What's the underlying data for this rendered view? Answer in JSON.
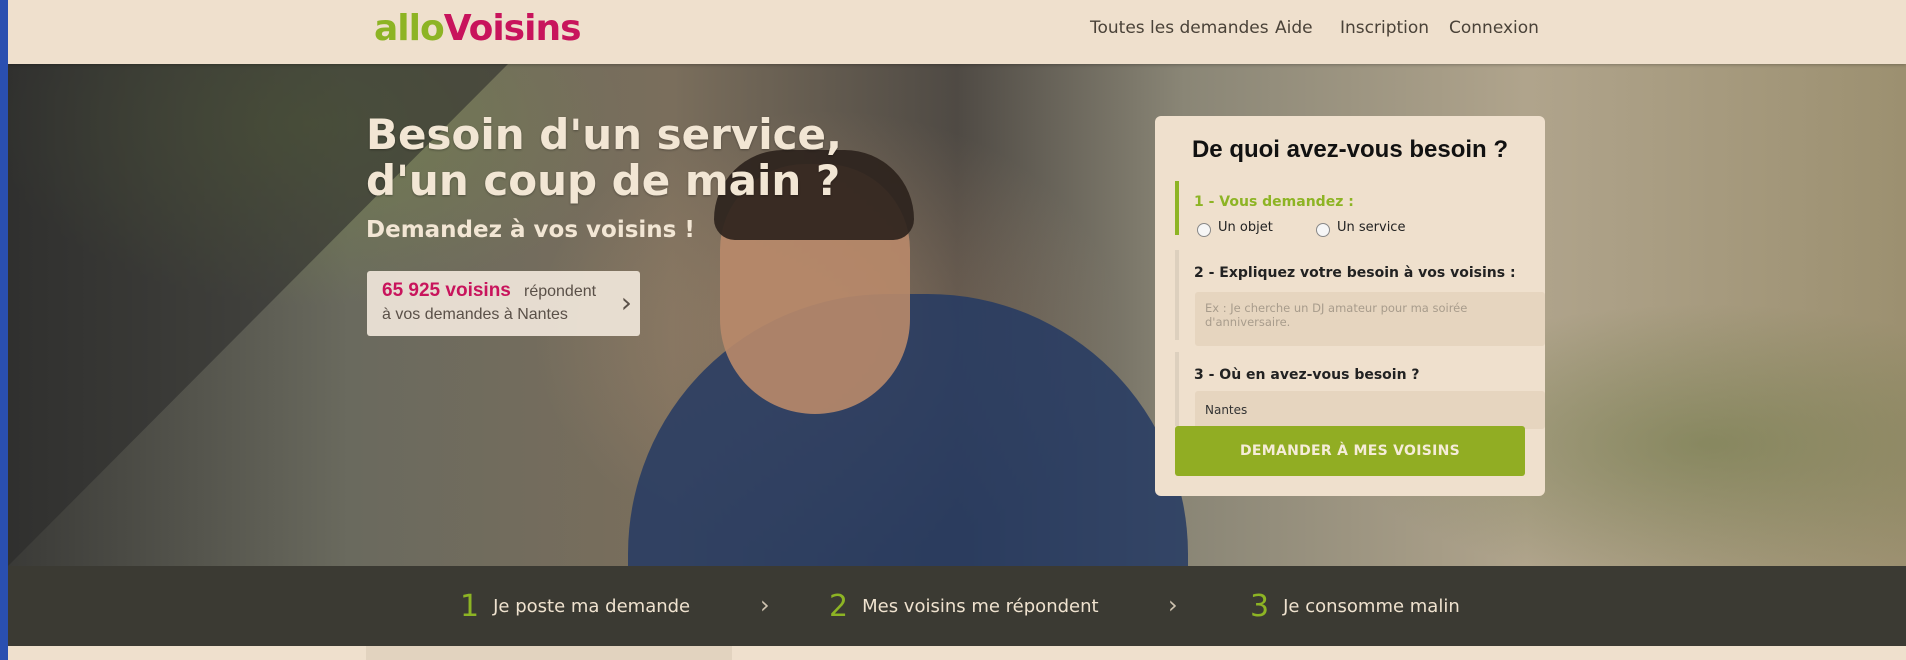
{
  "header": {
    "logo_part1": "allo",
    "logo_part2": "Voisins",
    "nav": [
      "Toutes les demandes",
      "Aide",
      "Inscription",
      "Connexion"
    ]
  },
  "hero": {
    "title": "Besoin d'un service,\nd'un coup de main ?",
    "subtitle": "Demandez à vos voisins !",
    "count_number": "65 925 voisins",
    "count_text1": "répondent",
    "count_text2": "à vos demandes à Nantes"
  },
  "form": {
    "title": "De quoi avez-vous besoin ?",
    "step1_label": "1 - Vous demandez :",
    "option1": "Un objet",
    "option2": "Un service",
    "step2_label": "2 - Expliquez votre besoin à vos voisins :",
    "need_placeholder": "Ex : Je cherche un DJ amateur pour ma soirée d'anniversaire.",
    "step3_label": "3 - Où en avez-vous besoin ?",
    "city_value": "Nantes",
    "submit_label": "DEMANDER À MES VOISINS"
  },
  "steps": [
    {
      "num": "1",
      "text": "Je poste ma demande"
    },
    {
      "num": "2",
      "text": "Mes voisins me répondent"
    },
    {
      "num": "3",
      "text": "Je consomme malin"
    }
  ],
  "colors": {
    "green": "#8db424",
    "pink": "#c8145c",
    "beige": "#efe0cd",
    "dark_bar": "#3b3a33"
  }
}
